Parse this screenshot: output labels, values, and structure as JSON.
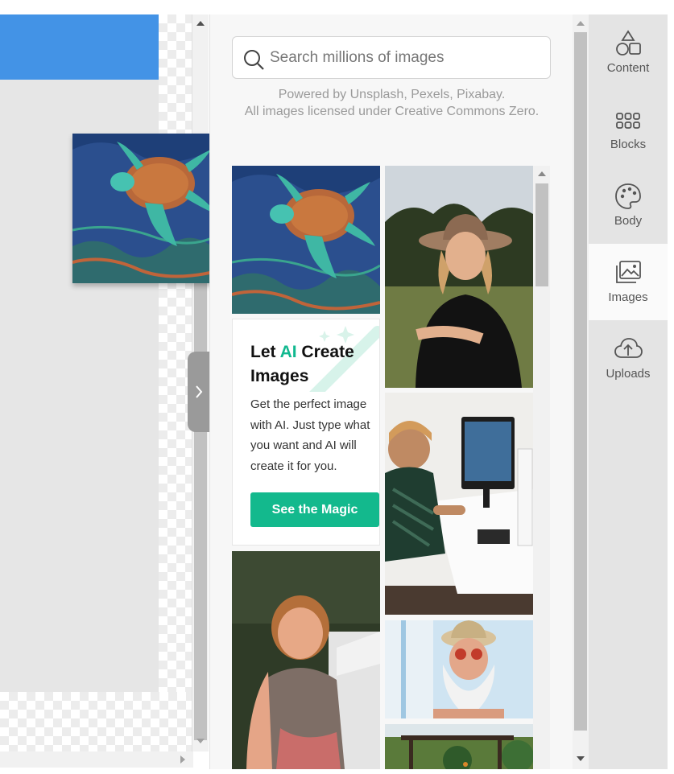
{
  "search": {
    "placeholder": "Search millions of images",
    "credits_line1": "Powered by Unsplash, Pexels, Pixabay.",
    "credits_line2": "All images licensed under Creative Commons Zero."
  },
  "ai_promo": {
    "title_prefix": "Let ",
    "title_accent": "AI",
    "title_suffix": " Create Images",
    "body": "Get the perfect image with AI. Just type what you want and AI will create it for you.",
    "button": "See the Magic"
  },
  "images": [
    {
      "name": "turtle-painting"
    },
    {
      "name": "woman-in-hat"
    },
    {
      "name": "man-at-computer"
    },
    {
      "name": "laughing-woman"
    },
    {
      "name": "bearded-man-sunglasses"
    },
    {
      "name": "pergola-garden"
    }
  ],
  "sidebar": {
    "items": [
      {
        "label": "Content",
        "icon": "shapes-icon",
        "active": false
      },
      {
        "label": "Blocks",
        "icon": "blocks-icon",
        "active": false
      },
      {
        "label": "Body",
        "icon": "palette-icon",
        "active": false
      },
      {
        "label": "Images",
        "icon": "images-icon",
        "active": true
      },
      {
        "label": "Uploads",
        "icon": "cloud-upload-icon",
        "active": false
      }
    ]
  },
  "colors": {
    "accent": "#13b98d",
    "canvas_block": "#4393e6"
  }
}
